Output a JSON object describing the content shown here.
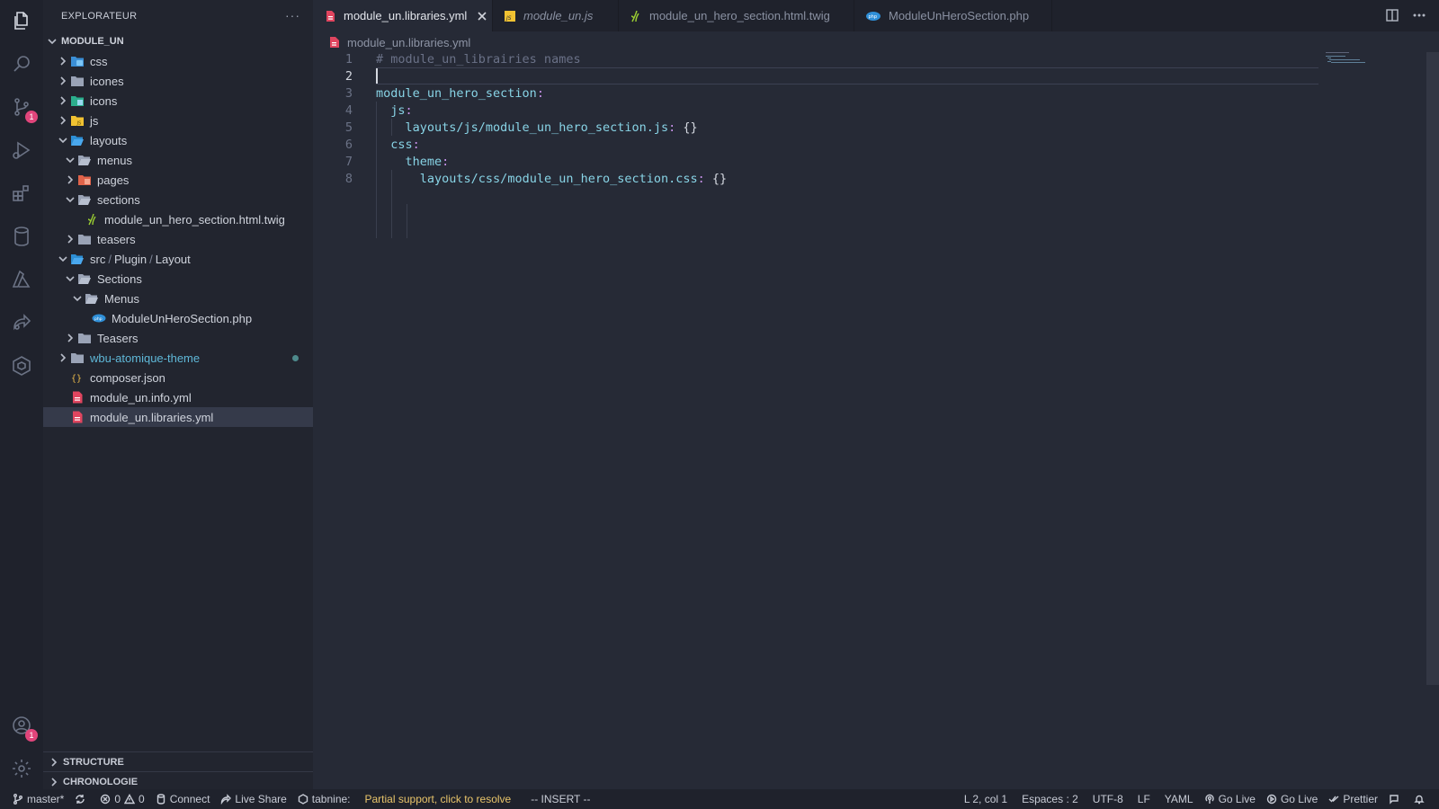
{
  "sidebar": {
    "title": "EXPLORATEUR",
    "more": "···",
    "root": "MODULE_UN",
    "items": [
      {
        "label": "css",
        "icon": "css-folder-icon",
        "expanded": false,
        "level": 0
      },
      {
        "label": "icones",
        "icon": "folder-icon",
        "expanded": false,
        "level": 0
      },
      {
        "label": "icons",
        "icon": "icons-folder-icon",
        "expanded": false,
        "level": 0
      },
      {
        "label": "js",
        "icon": "js-folder-icon",
        "expanded": false,
        "level": 0
      },
      {
        "label": "layouts",
        "icon": "layouts-folder-icon",
        "expanded": true,
        "level": 0
      },
      {
        "label": "menus",
        "icon": "folder-open-icon",
        "expanded": true,
        "level": 1
      },
      {
        "label": "pages",
        "icon": "pages-folder-icon",
        "expanded": false,
        "level": 1
      },
      {
        "label": "sections",
        "icon": "folder-open-icon",
        "expanded": true,
        "level": 1
      },
      {
        "label": "module_un_hero_section.html.twig",
        "icon": "twig-file-icon",
        "level": 2
      },
      {
        "label": "teasers",
        "icon": "folder-icon",
        "expanded": false,
        "level": 1
      },
      {
        "label": "src",
        "label_parts": [
          "src",
          "/",
          "Plugin",
          "/",
          "Layout"
        ],
        "icon": "src-folder-icon",
        "expanded": true,
        "level": 0
      },
      {
        "label": "Sections",
        "icon": "folder-open-icon",
        "expanded": true,
        "level": 1
      },
      {
        "label": "Menus",
        "icon": "folder-open-icon",
        "expanded": true,
        "level": 2
      },
      {
        "label": "ModuleUnHeroSection.php",
        "icon": "php-file-icon",
        "level": 3
      },
      {
        "label": "Teasers",
        "icon": "folder-icon",
        "expanded": false,
        "level": 1
      },
      {
        "label": "wbu-atomique-theme",
        "icon": "folder-icon",
        "expanded": false,
        "level": 0
      },
      {
        "label": "composer.json",
        "icon": "json-file-icon",
        "level": 0
      },
      {
        "label": "module_un.info.yml",
        "icon": "yml-file-icon",
        "level": 0
      },
      {
        "label": "module_un.libraries.yml",
        "icon": "yml-file-icon",
        "level": 0,
        "selected": true
      }
    ],
    "sections": [
      "STRUCTURE",
      "CHRONOLOGIE"
    ]
  },
  "tabs": [
    {
      "label": "module_un.libraries.yml",
      "icon": "yml-file-icon",
      "active": true
    },
    {
      "label": "module_un.js",
      "icon": "js-file-icon",
      "active": false
    },
    {
      "label": "module_un_hero_section.html.twig",
      "icon": "twig-file-icon",
      "active": false
    },
    {
      "label": "ModuleUnHeroSection.php",
      "icon": "php-file-icon",
      "active": false
    }
  ],
  "breadcrumb": "module_un.libraries.yml",
  "editor": {
    "lines": [
      {
        "n": "1",
        "text": "# module_un_librairies names"
      },
      {
        "n": "2",
        "text": ""
      },
      {
        "n": "3",
        "key": "module_un_hero_section",
        "indent": ""
      },
      {
        "n": "4",
        "key": "js",
        "indent": "  "
      },
      {
        "n": "5",
        "key": "layouts/js/module_un_hero_section.js",
        "value": "{}",
        "indent": "    "
      },
      {
        "n": "6",
        "key": "css",
        "indent": "  "
      },
      {
        "n": "7",
        "key": "theme",
        "indent": "    "
      },
      {
        "n": "8",
        "key": "layouts/css/module_un_hero_section.css",
        "value": "{}",
        "indent": "      "
      }
    ],
    "current_line": 2
  },
  "statusbar": {
    "branch": "master*",
    "errors": "0",
    "warnings": "0",
    "connect": "Connect",
    "live_share": "Live Share",
    "tabnine": "tabnine:",
    "tabnine_msg": "Partial support, click to resolve",
    "mode": "-- INSERT --",
    "position": "L 2, col 1",
    "spaces": "Espaces : 2",
    "encoding": "UTF-8",
    "eol": "LF",
    "language": "YAML",
    "go_live_1": "Go Live",
    "go_live_2": "Go Live",
    "prettier": "Prettier"
  },
  "badges": {
    "source_control": "1",
    "accounts": "1"
  }
}
